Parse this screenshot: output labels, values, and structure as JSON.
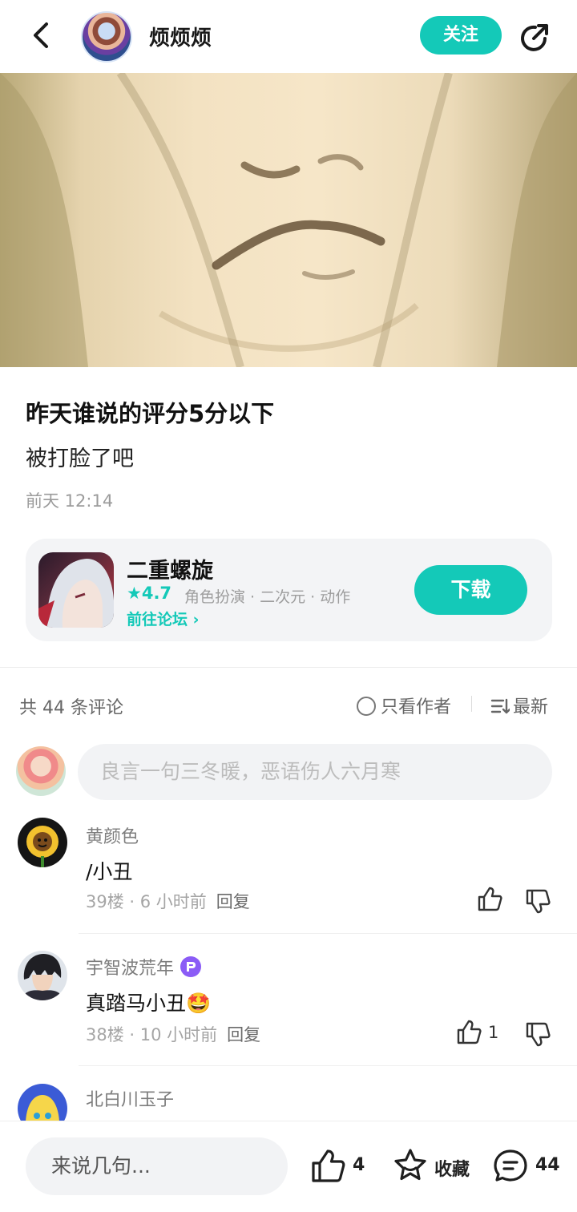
{
  "header": {
    "author_name": "烦烦烦",
    "follow_label": "关注"
  },
  "post": {
    "title": "昨天谁说的评分5分以下",
    "body": "被打脸了吧",
    "time": "前天 12:14"
  },
  "game": {
    "name": "二重螺旋",
    "rating": "★4.7",
    "tags": "角色扮演 · 二次元 · 动作",
    "forum_link": "前往论坛 ›",
    "download_label": "下载"
  },
  "comments_toolbar": {
    "count_label": "共 44 条评论",
    "author_only_label": "只看作者",
    "sort_label": "最新"
  },
  "comment_input": {
    "placeholder": "良言一句三冬暖，恶语伤人六月寒"
  },
  "comments": [
    {
      "user": "黄颜色",
      "text": "/小丑",
      "floor": "39楼 · 6 小时前",
      "reply": "回复",
      "likes": ""
    },
    {
      "user": "宇智波荒年",
      "text": "真踏马小丑🤩",
      "floor": "38楼 · 10 小时前",
      "reply": "回复",
      "likes": "1"
    },
    {
      "user": "北白川玉子"
    }
  ],
  "bottom_bar": {
    "input_placeholder": "来说几句...",
    "like_count": "4",
    "favorite_label": "收藏",
    "comment_count": "44"
  },
  "icons": [
    "back-arrow-icon",
    "share-icon",
    "star-icon",
    "chevron-right-icon",
    "circle-icon",
    "sort-icon",
    "thumbs-up-icon",
    "thumbs-down-icon",
    "vip-badge-icon",
    "favorite-star-icon",
    "comment-bubble-icon"
  ],
  "colors": {
    "accent": "#14c9b8",
    "vip": "#8b5cf6"
  }
}
